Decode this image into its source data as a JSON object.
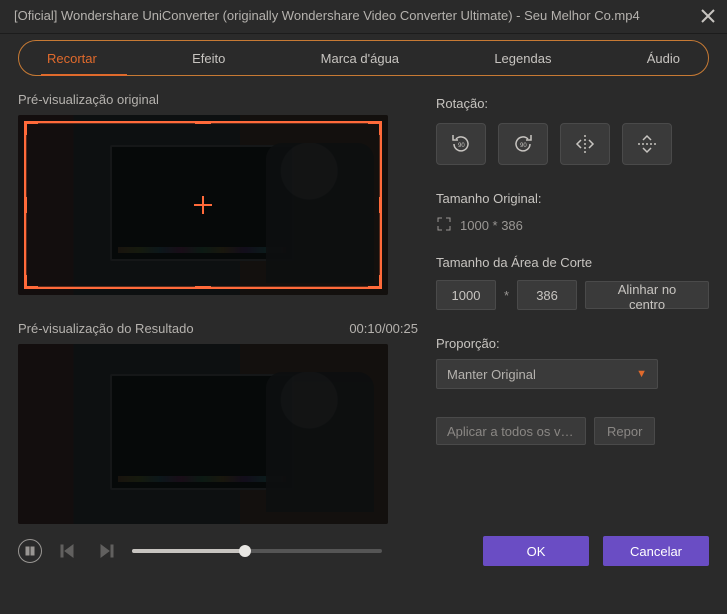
{
  "title": "[Oficial] Wondershare UniConverter (originally Wondershare Video Converter Ultimate) - Seu Melhor Co.mp4",
  "tabs": {
    "items": [
      "Recortar",
      "Efeito",
      "Marca d'água",
      "Legendas",
      "Áudio"
    ],
    "active_index": 0
  },
  "left": {
    "original_label": "Pré-visualização original",
    "result_label": "Pré-visualização do Resultado",
    "timecode": "00:10/00:25"
  },
  "right": {
    "rotation_label": "Rotação:",
    "original_size_label": "Tamanho Original:",
    "original_size_value": "1000 * 386",
    "crop_size_label": "Tamanho da Área de Corte",
    "crop_width": "1000",
    "crop_height": "386",
    "center_btn": "Alinhar no centro",
    "aspect_label": "Proporção:",
    "aspect_value": "Manter Original",
    "apply_all": "Aplicar a todos os víd...",
    "reset": "Repor"
  },
  "footer": {
    "ok": "OK",
    "cancel": "Cancelar"
  }
}
